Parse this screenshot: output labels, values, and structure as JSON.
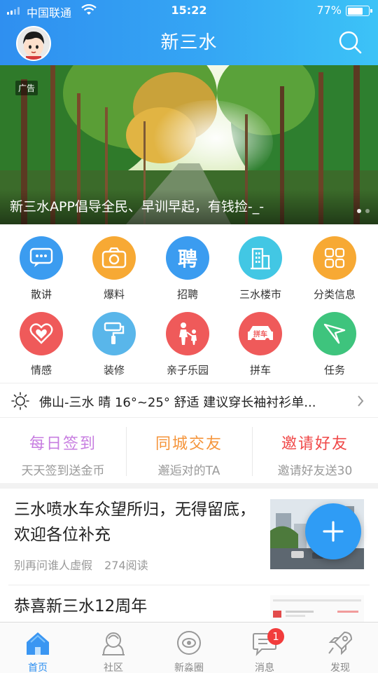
{
  "status_bar": {
    "carrier": "中国联通",
    "time": "15:22",
    "battery_pct": "77%",
    "battery_level": 0.77
  },
  "nav": {
    "title": "新三水",
    "search_icon": "search-icon",
    "avatar_icon": "avatar-icon"
  },
  "banner": {
    "ad_tag": "广告",
    "caption": "新三水APP倡导全民、早训早起，有钱捡-_-",
    "page_count": 2,
    "active_page": 1
  },
  "grid": [
    {
      "label": "散讲",
      "icon": "chat-icon",
      "color": "#3b9cf0"
    },
    {
      "label": "爆料",
      "icon": "camera-icon",
      "color": "#f7a934"
    },
    {
      "label": "招聘",
      "icon": "recruit-icon",
      "glyph": "聘",
      "color": "#3b9cf0"
    },
    {
      "label": "三水楼市",
      "icon": "building-icon",
      "color": "#42c7e4"
    },
    {
      "label": "分类信息",
      "icon": "category-icon",
      "color": "#f7a934"
    },
    {
      "label": "情感",
      "icon": "heart-icon",
      "color": "#ef5a5a"
    },
    {
      "label": "装修",
      "icon": "paint-roller-icon",
      "color": "#59b6ea"
    },
    {
      "label": "亲子乐园",
      "icon": "parent-child-icon",
      "color": "#ef5a5a"
    },
    {
      "label": "拼车",
      "icon": "car-icon",
      "glyph": "拼车",
      "color": "#ef5a5a"
    },
    {
      "label": "任务",
      "icon": "paper-plane-icon",
      "color": "#3ec47d"
    }
  ],
  "weather": {
    "text": "佛山-三水 晴 16°~25° 舒适 建议穿长袖衬衫单...",
    "icon": "sun-icon"
  },
  "activities": [
    {
      "title": "每日签到",
      "subtitle": "天天签到送金币",
      "color": "#c77de0"
    },
    {
      "title": "同城交友",
      "subtitle": "邂逅对的TA",
      "color": "#f5943a"
    },
    {
      "title": "邀请好友",
      "subtitle": "邀请好友送30",
      "color": "#f04848"
    }
  ],
  "news": [
    {
      "title": "三水喷水车众望所归，无得留底，欢迎各位补充",
      "author": "别再问谁人虚假",
      "reads": "274阅读"
    },
    {
      "title": "恭喜新三水12周年",
      "author": "",
      "reads": ""
    }
  ],
  "tabbar": [
    {
      "label": "首页",
      "icon": "home-icon",
      "active": true
    },
    {
      "label": "社区",
      "icon": "community-icon",
      "active": false
    },
    {
      "label": "新淼圈",
      "icon": "circle-icon",
      "active": false
    },
    {
      "label": "消息",
      "icon": "message-icon",
      "active": false,
      "badge": "1"
    },
    {
      "label": "发现",
      "icon": "rocket-icon",
      "active": false
    }
  ]
}
